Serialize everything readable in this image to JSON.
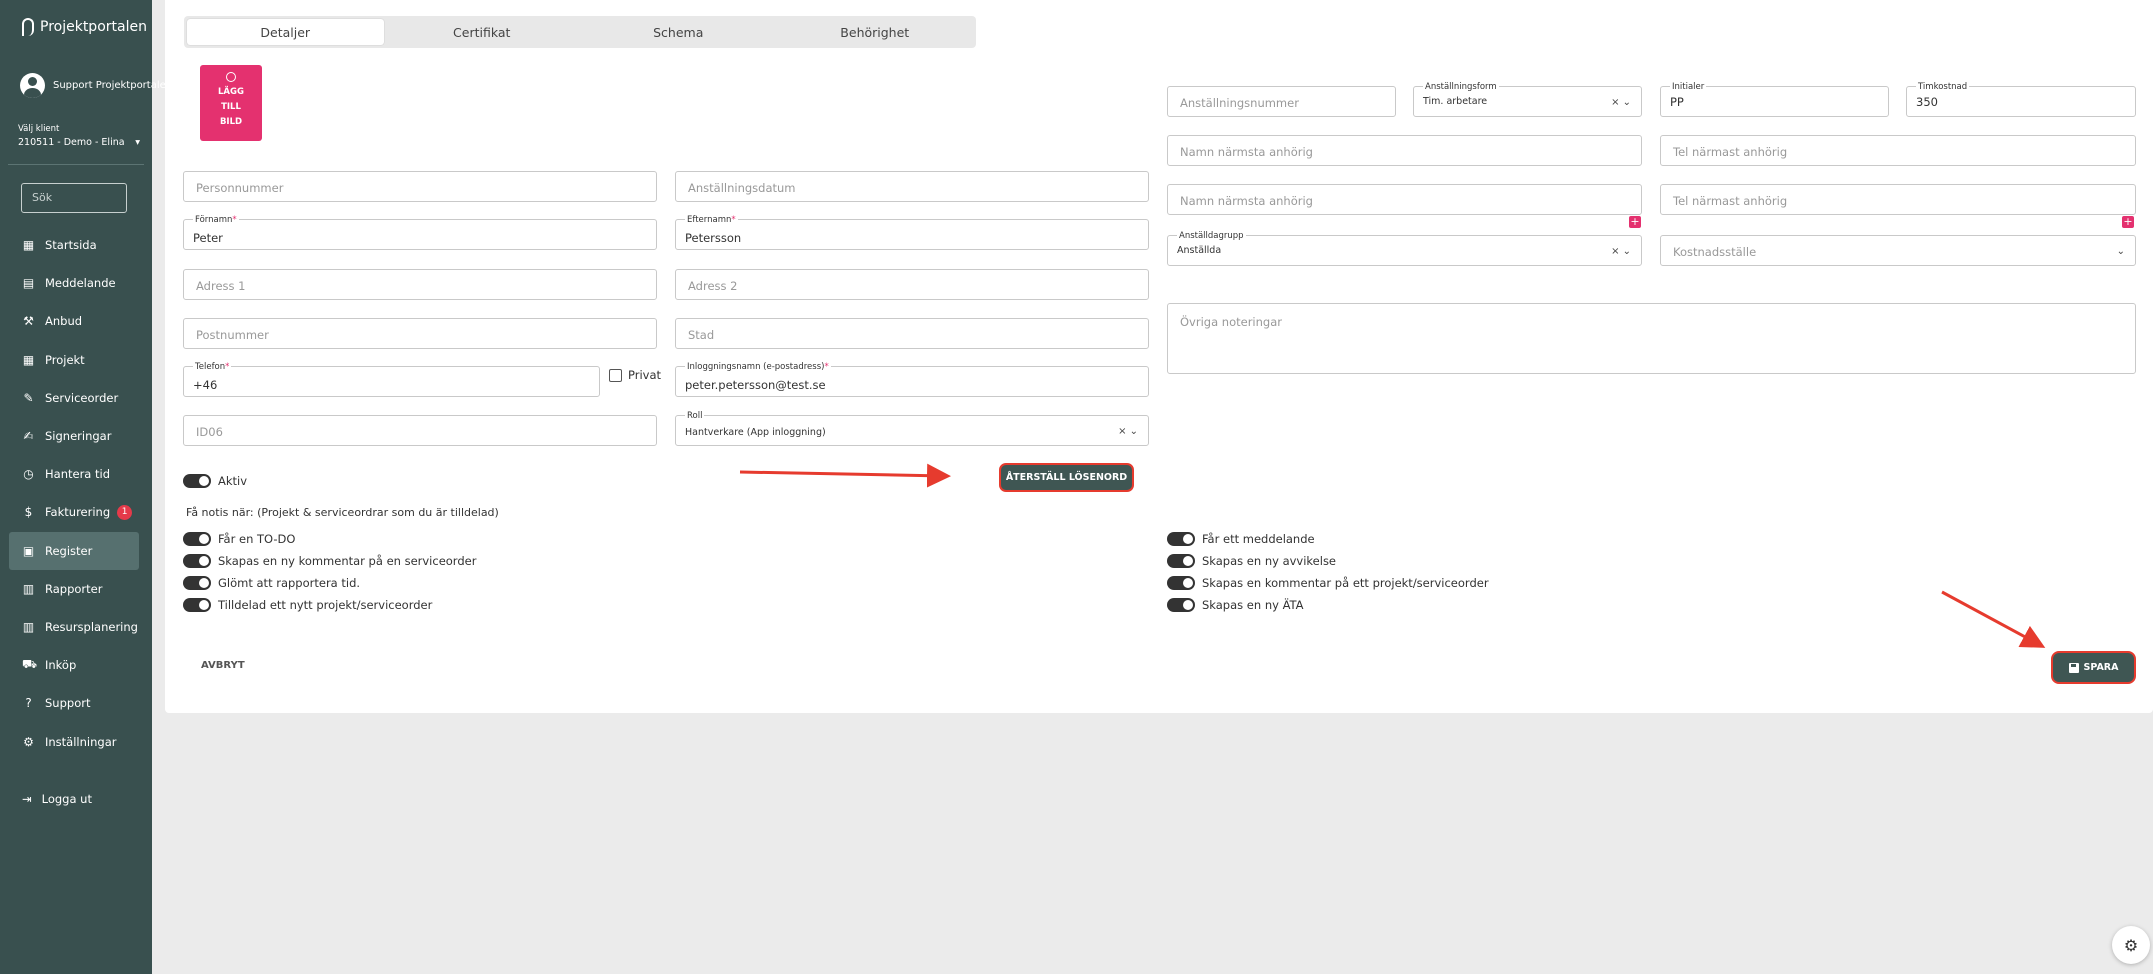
{
  "app": {
    "name": "Projektportalen"
  },
  "user": {
    "name": "Support Projektportalen"
  },
  "client": {
    "label": "Välj klient",
    "value": "210511 - Demo - Elina"
  },
  "search": {
    "placeholder": "Sök"
  },
  "nav": [
    {
      "label": "Startsida",
      "icon": "dashboard-icon"
    },
    {
      "label": "Meddelande",
      "icon": "message-icon"
    },
    {
      "label": "Anbud",
      "icon": "gavel-icon"
    },
    {
      "label": "Projekt",
      "icon": "grid-icon"
    },
    {
      "label": "Serviceorder",
      "icon": "wrench-icon"
    },
    {
      "label": "Signeringar",
      "icon": "signature-icon"
    },
    {
      "label": "Hantera tid",
      "icon": "clock-icon"
    },
    {
      "label": "Fakturering",
      "icon": "dollar-icon",
      "badge": "1"
    },
    {
      "label": "Register",
      "icon": "register-icon",
      "active": true
    },
    {
      "label": "Rapporter",
      "icon": "calendar-icon"
    },
    {
      "label": "Resursplanering",
      "icon": "calendar-icon"
    },
    {
      "label": "Inköp",
      "icon": "cart-icon"
    },
    {
      "label": "Support",
      "icon": "help-icon"
    },
    {
      "label": "Inställningar",
      "icon": "gear-icon"
    }
  ],
  "logout": {
    "label": "Logga ut"
  },
  "tabs": [
    "Detaljer",
    "Certifikat",
    "Schema",
    "Behörighet"
  ],
  "add_picture": {
    "line1": "LÄGG",
    "line2": "TILL",
    "line3": "BILD"
  },
  "form": {
    "personnummer": {
      "placeholder": "Personnummer"
    },
    "anstallningsdatum": {
      "placeholder": "Anställningsdatum"
    },
    "fornamn": {
      "label": "Förnamn",
      "value": "Peter"
    },
    "efternamn": {
      "label": "Efternamn",
      "value": "Petersson"
    },
    "adress1": {
      "placeholder": "Adress 1"
    },
    "adress2": {
      "placeholder": "Adress 2"
    },
    "postnummer": {
      "placeholder": "Postnummer"
    },
    "stad": {
      "placeholder": "Stad"
    },
    "telefon": {
      "label": "Telefon",
      "value": "+46"
    },
    "privat": {
      "label": "Privat"
    },
    "inloggningsnamn": {
      "label": "Inloggningsnamn (e-postadress)",
      "value": "peter.petersson@test.se"
    },
    "id06": {
      "placeholder": "ID06"
    },
    "roll": {
      "label": "Roll",
      "value": "Hantverkare (App inloggning)"
    },
    "anstallningsnummer": {
      "placeholder": "Anställningsnummer"
    },
    "anstallningsform": {
      "label": "Anställningsform",
      "value": "Tim. arbetare"
    },
    "initialer": {
      "label": "Initialer",
      "value": "PP"
    },
    "timkostnad": {
      "label": "Timkostnad",
      "value": "350"
    },
    "namn_anhorig_1": {
      "placeholder": "Namn närmsta anhörig"
    },
    "tel_anhorig_1": {
      "placeholder": "Tel närmast anhörig"
    },
    "namn_anhorig_2": {
      "placeholder": "Namn närmsta anhörig"
    },
    "tel_anhorig_2": {
      "placeholder": "Tel närmast anhörig"
    },
    "anstalldagrupp": {
      "label": "Anställdagrupp",
      "value": "Anställda"
    },
    "kostnadsstalle": {
      "placeholder": "Kostnadsställe"
    },
    "ovriga": {
      "placeholder": "Övriga noteringar"
    }
  },
  "aktiv": {
    "label": "Aktiv"
  },
  "reset_password": {
    "label": "ÅTERSTÄLL LÖSENORD"
  },
  "notis_heading": "Få notis när: (Projekt & serviceordrar som du är tilldelad)",
  "notis_left": [
    "Får en TO-DO",
    "Skapas en ny kommentar på en serviceorder",
    "Glömt att rapportera tid.",
    "Tilldelad ett nytt projekt/serviceorder"
  ],
  "notis_right": [
    "Får ett meddelande",
    "Skapas en ny avvikelse",
    "Skapas en kommentar på ett projekt/serviceorder",
    "Skapas en ny ÄTA"
  ],
  "buttons": {
    "cancel": "AVBRYT",
    "save": "SPARA"
  },
  "colors": {
    "sidebar": "#39504f",
    "accent": "#e4316f",
    "button": "#3f5653",
    "highlight": "#e63b2e"
  }
}
